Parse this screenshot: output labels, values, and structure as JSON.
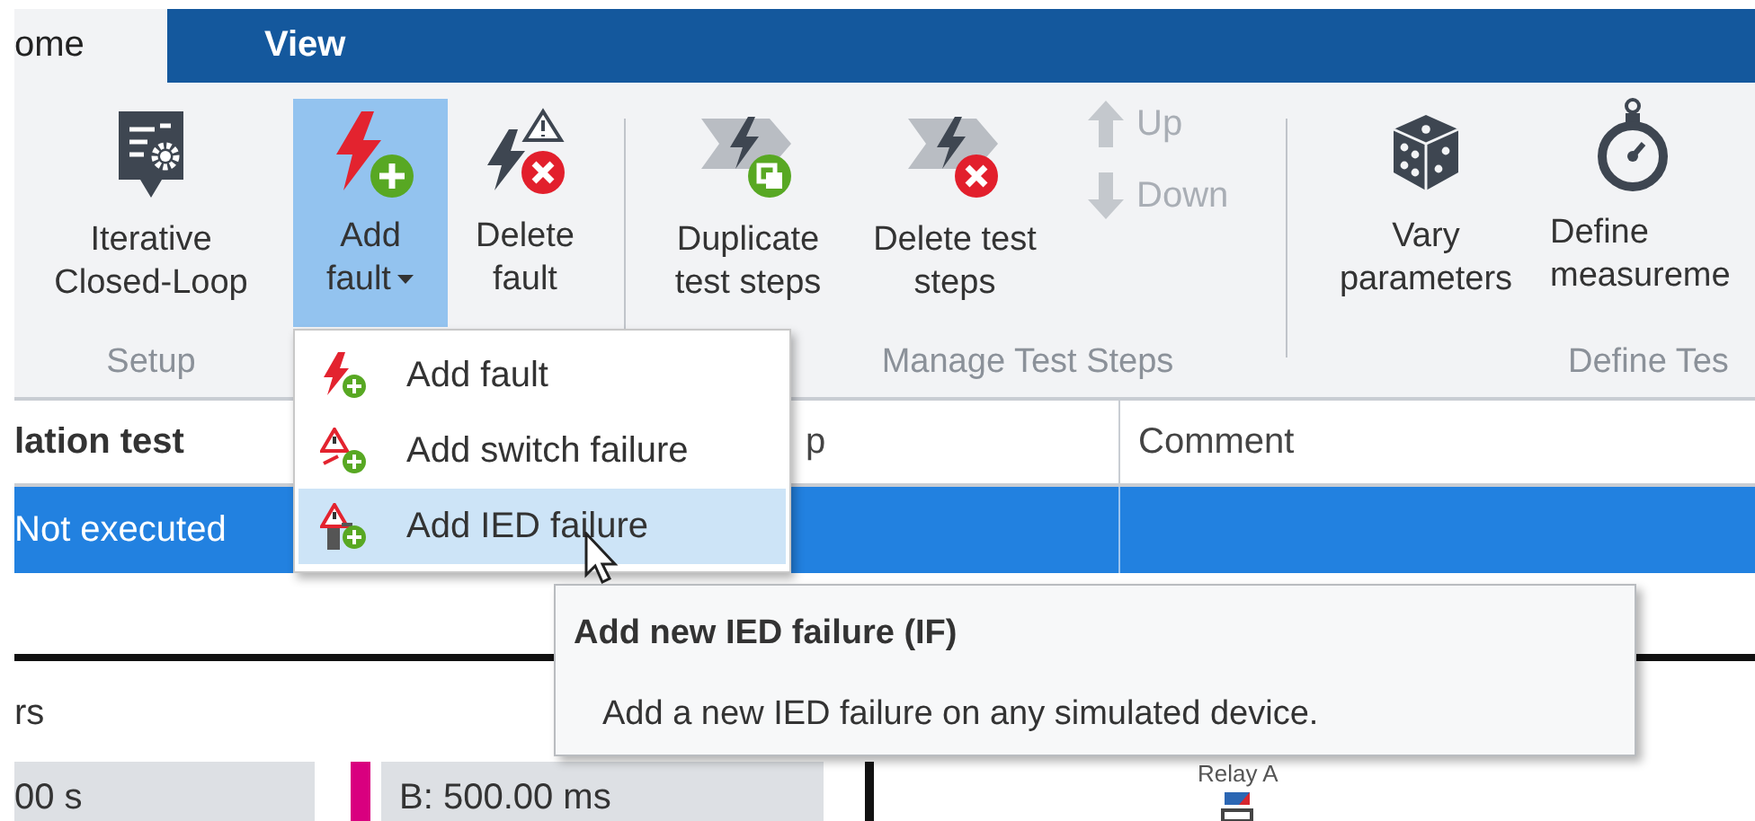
{
  "tabs": [
    {
      "label": "ome",
      "selected": true
    },
    {
      "label": "View",
      "selected": false
    }
  ],
  "ribbon": {
    "buttons": [
      {
        "lines": [
          "Iterative",
          "Closed-Loop"
        ],
        "selected": false
      },
      {
        "lines": [
          "Add",
          "fault"
        ],
        "selected": true,
        "dropdown": true
      },
      {
        "lines": [
          "Delete",
          "fault"
        ],
        "selected": false,
        "dropdown": false
      },
      {
        "lines": [
          "Duplicate",
          "test steps"
        ],
        "selected": false
      },
      {
        "lines": [
          "Delete test",
          "steps"
        ],
        "selected": false
      },
      {
        "lines": [
          "Vary",
          "parameters"
        ],
        "selected": false
      },
      {
        "lines": [
          "Define",
          "measureme"
        ],
        "selected": false
      }
    ],
    "small_buttons": [
      {
        "label": "Up",
        "disabled": true
      },
      {
        "label": "Down",
        "disabled": true
      }
    ],
    "group_labels": [
      "Setup",
      "Manage Test Steps",
      "Define Tes"
    ]
  },
  "table": {
    "columns": [
      "lation test",
      "p",
      "Comment"
    ],
    "rows": [
      {
        "status": "Not executed",
        "selected": true
      }
    ]
  },
  "timeline": {
    "heading": "rs",
    "fields": [
      "00 s",
      "B: 500.00 ms"
    ]
  },
  "diagram": {
    "label": "Relay A"
  },
  "menu": {
    "items": [
      {
        "label": "Add fault",
        "selected": false
      },
      {
        "label": "Add switch failure",
        "selected": false
      },
      {
        "label": "Add IED failure",
        "selected": true
      }
    ]
  },
  "tooltip": {
    "title": "Add new IED failure (IF)",
    "text": "Add a new IED failure on any simulated device."
  }
}
